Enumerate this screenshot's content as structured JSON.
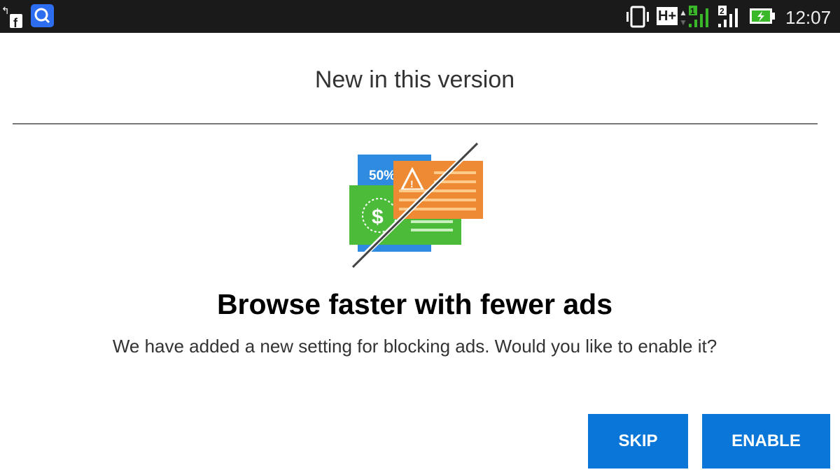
{
  "status_bar": {
    "time": "12:07",
    "network_type": "H+",
    "sim1_label": "1",
    "sim2_label": "2",
    "icons": [
      "missed-call-icon",
      "facebook-icon",
      "search-app-icon",
      "vibrate-icon",
      "network-h-plus-icon",
      "signal-sim1-icon",
      "signal-sim2-icon",
      "battery-charging-icon"
    ]
  },
  "dialog": {
    "title": "New in this version",
    "illustration_badge": "50%",
    "headline": "Browse faster with fewer ads",
    "body": "We have added a new setting for blocking ads. Would you like to enable it?",
    "skip_label": "SKIP",
    "enable_label": "ENABLE"
  },
  "colors": {
    "accent": "#0a77d8",
    "blue": "#2f8be0",
    "green": "#4cbb3a",
    "orange": "#ef8a34"
  }
}
